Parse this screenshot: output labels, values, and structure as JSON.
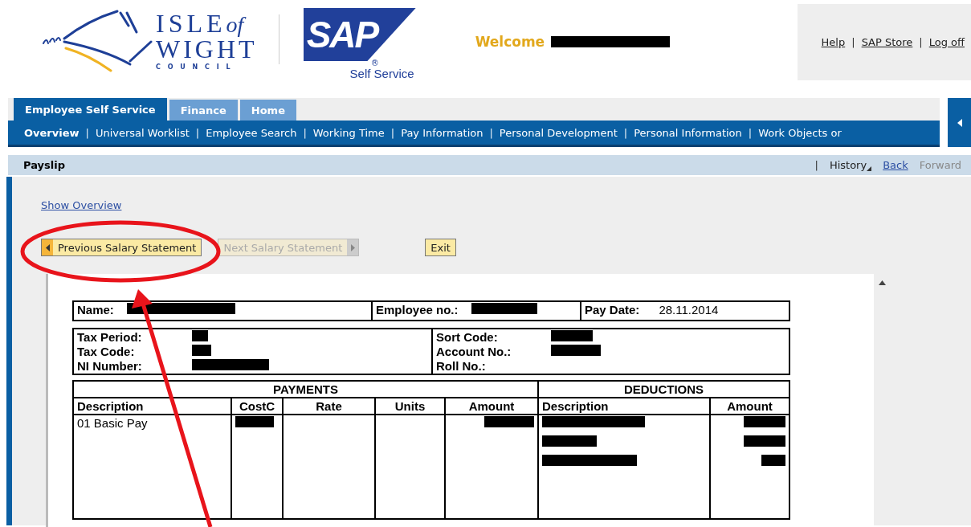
{
  "header": {
    "council_logo": {
      "line1": "ISLE",
      "line1_suffix": "of",
      "line2": "WIGHT",
      "line3": "C O U N C I L"
    },
    "sap_logo": {
      "mark": "SAP",
      "registered": "®",
      "caption": "Self Service"
    },
    "welcome": {
      "label": "Welcome",
      "name_redacted": true
    },
    "links": [
      {
        "label": "Help"
      },
      {
        "label": "SAP Store",
        "separator": "|"
      },
      {
        "label": "Log off",
        "separator": "|"
      }
    ]
  },
  "tabs": [
    {
      "label": "Employee Self Service",
      "selected": true
    },
    {
      "label": "Finance",
      "selected": false
    },
    {
      "label": "Home",
      "selected": false
    }
  ],
  "subnav": [
    {
      "label": "Overview",
      "selected": true
    },
    {
      "label": "Universal Worklist",
      "selected": false,
      "separator": "|"
    },
    {
      "label": "Employee Search",
      "selected": false,
      "separator": "|"
    },
    {
      "label": "Working Time",
      "selected": false,
      "separator": "|"
    },
    {
      "label": "Pay Information",
      "selected": false,
      "separator": "|"
    },
    {
      "label": "Personal Development",
      "selected": false,
      "separator": "|"
    },
    {
      "label": "Personal Information",
      "selected": false,
      "separator": "|"
    },
    {
      "label": "Work Objects or",
      "selected": false,
      "separator": "|"
    }
  ],
  "page_title": "Payslip",
  "history_nav": [
    {
      "label": "History",
      "kind": "menu",
      "separator": "|"
    },
    {
      "label": "Back",
      "kind": "link",
      "disabled": false
    },
    {
      "label": "Forward",
      "kind": "link",
      "disabled": true
    }
  ],
  "show_overview": "Show Overview",
  "buttons": [
    {
      "label": "Previous Salary Statement",
      "kind": "prev",
      "disabled": false
    },
    {
      "label": "Next Salary Statement",
      "kind": "next",
      "disabled": true
    },
    {
      "label": "Exit",
      "kind": "plain",
      "disabled": false
    }
  ],
  "payslip": {
    "row1": [
      {
        "label": "Name:",
        "redacted": true
      },
      {
        "label": "Employee no.:",
        "redacted": true
      },
      {
        "label": "Pay Date:",
        "value": "28.11.2014"
      }
    ],
    "left_fields": [
      {
        "label": "Tax Period:",
        "redacted": true
      },
      {
        "label": "Tax Code:",
        "redacted": true
      },
      {
        "label": "NI Number:",
        "redacted": true
      }
    ],
    "right_fields": [
      {
        "label": "Sort Code:",
        "redacted": true
      },
      {
        "label": "Account No.:",
        "redacted": true
      },
      {
        "label": "Roll No.:"
      }
    ],
    "payments_title": "PAYMENTS",
    "deductions_title": "DEDUCTIONS",
    "columns": [
      "Description",
      "CostC",
      "Rate",
      "Units",
      "Amount",
      "Description",
      "Amount"
    ],
    "payment_rows": [
      {
        "description": "01 Basic Pay",
        "costc_redacted": true,
        "amount_redacted": true
      }
    ],
    "deduction_rows": [
      {
        "description_redacted": true,
        "amount_redacted": true
      },
      {
        "description_redacted": true,
        "amount_redacted": true
      },
      {
        "description_redacted": true,
        "amount_redacted": true
      }
    ]
  },
  "annotations": [
    {
      "kind": "ellipse",
      "color": "#e8141b"
    },
    {
      "kind": "arrow",
      "color": "#e8141b"
    }
  ]
}
